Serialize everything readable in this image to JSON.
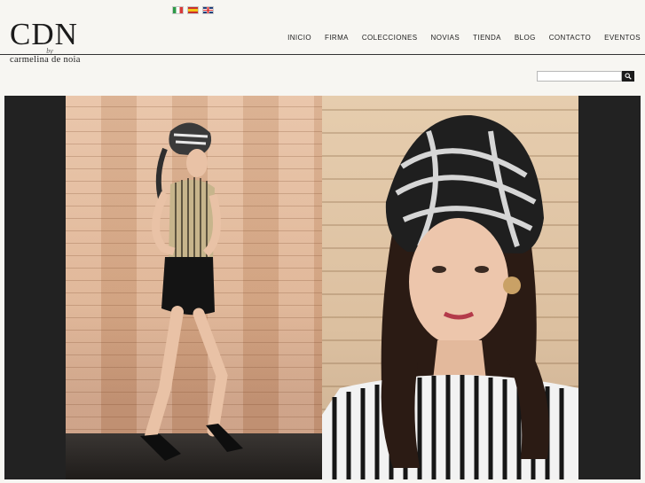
{
  "languages": [
    {
      "code": "it",
      "label": "Italiano"
    },
    {
      "code": "es",
      "label": "Español"
    },
    {
      "code": "en",
      "label": "English"
    }
  ],
  "logo": {
    "main": "CDN",
    "by": "by",
    "sub": "carmelina de noia"
  },
  "nav": {
    "items": [
      "INICIO",
      "FIRMA",
      "COLECCIONES",
      "NOVIAS",
      "TIENDA",
      "BLOG",
      "CONTACTO",
      "EVENTOS"
    ]
  },
  "search": {
    "placeholder": "",
    "value": ""
  },
  "colors": {
    "background": "#f7f6f2",
    "text": "#222222",
    "banner_frame": "#222222"
  }
}
